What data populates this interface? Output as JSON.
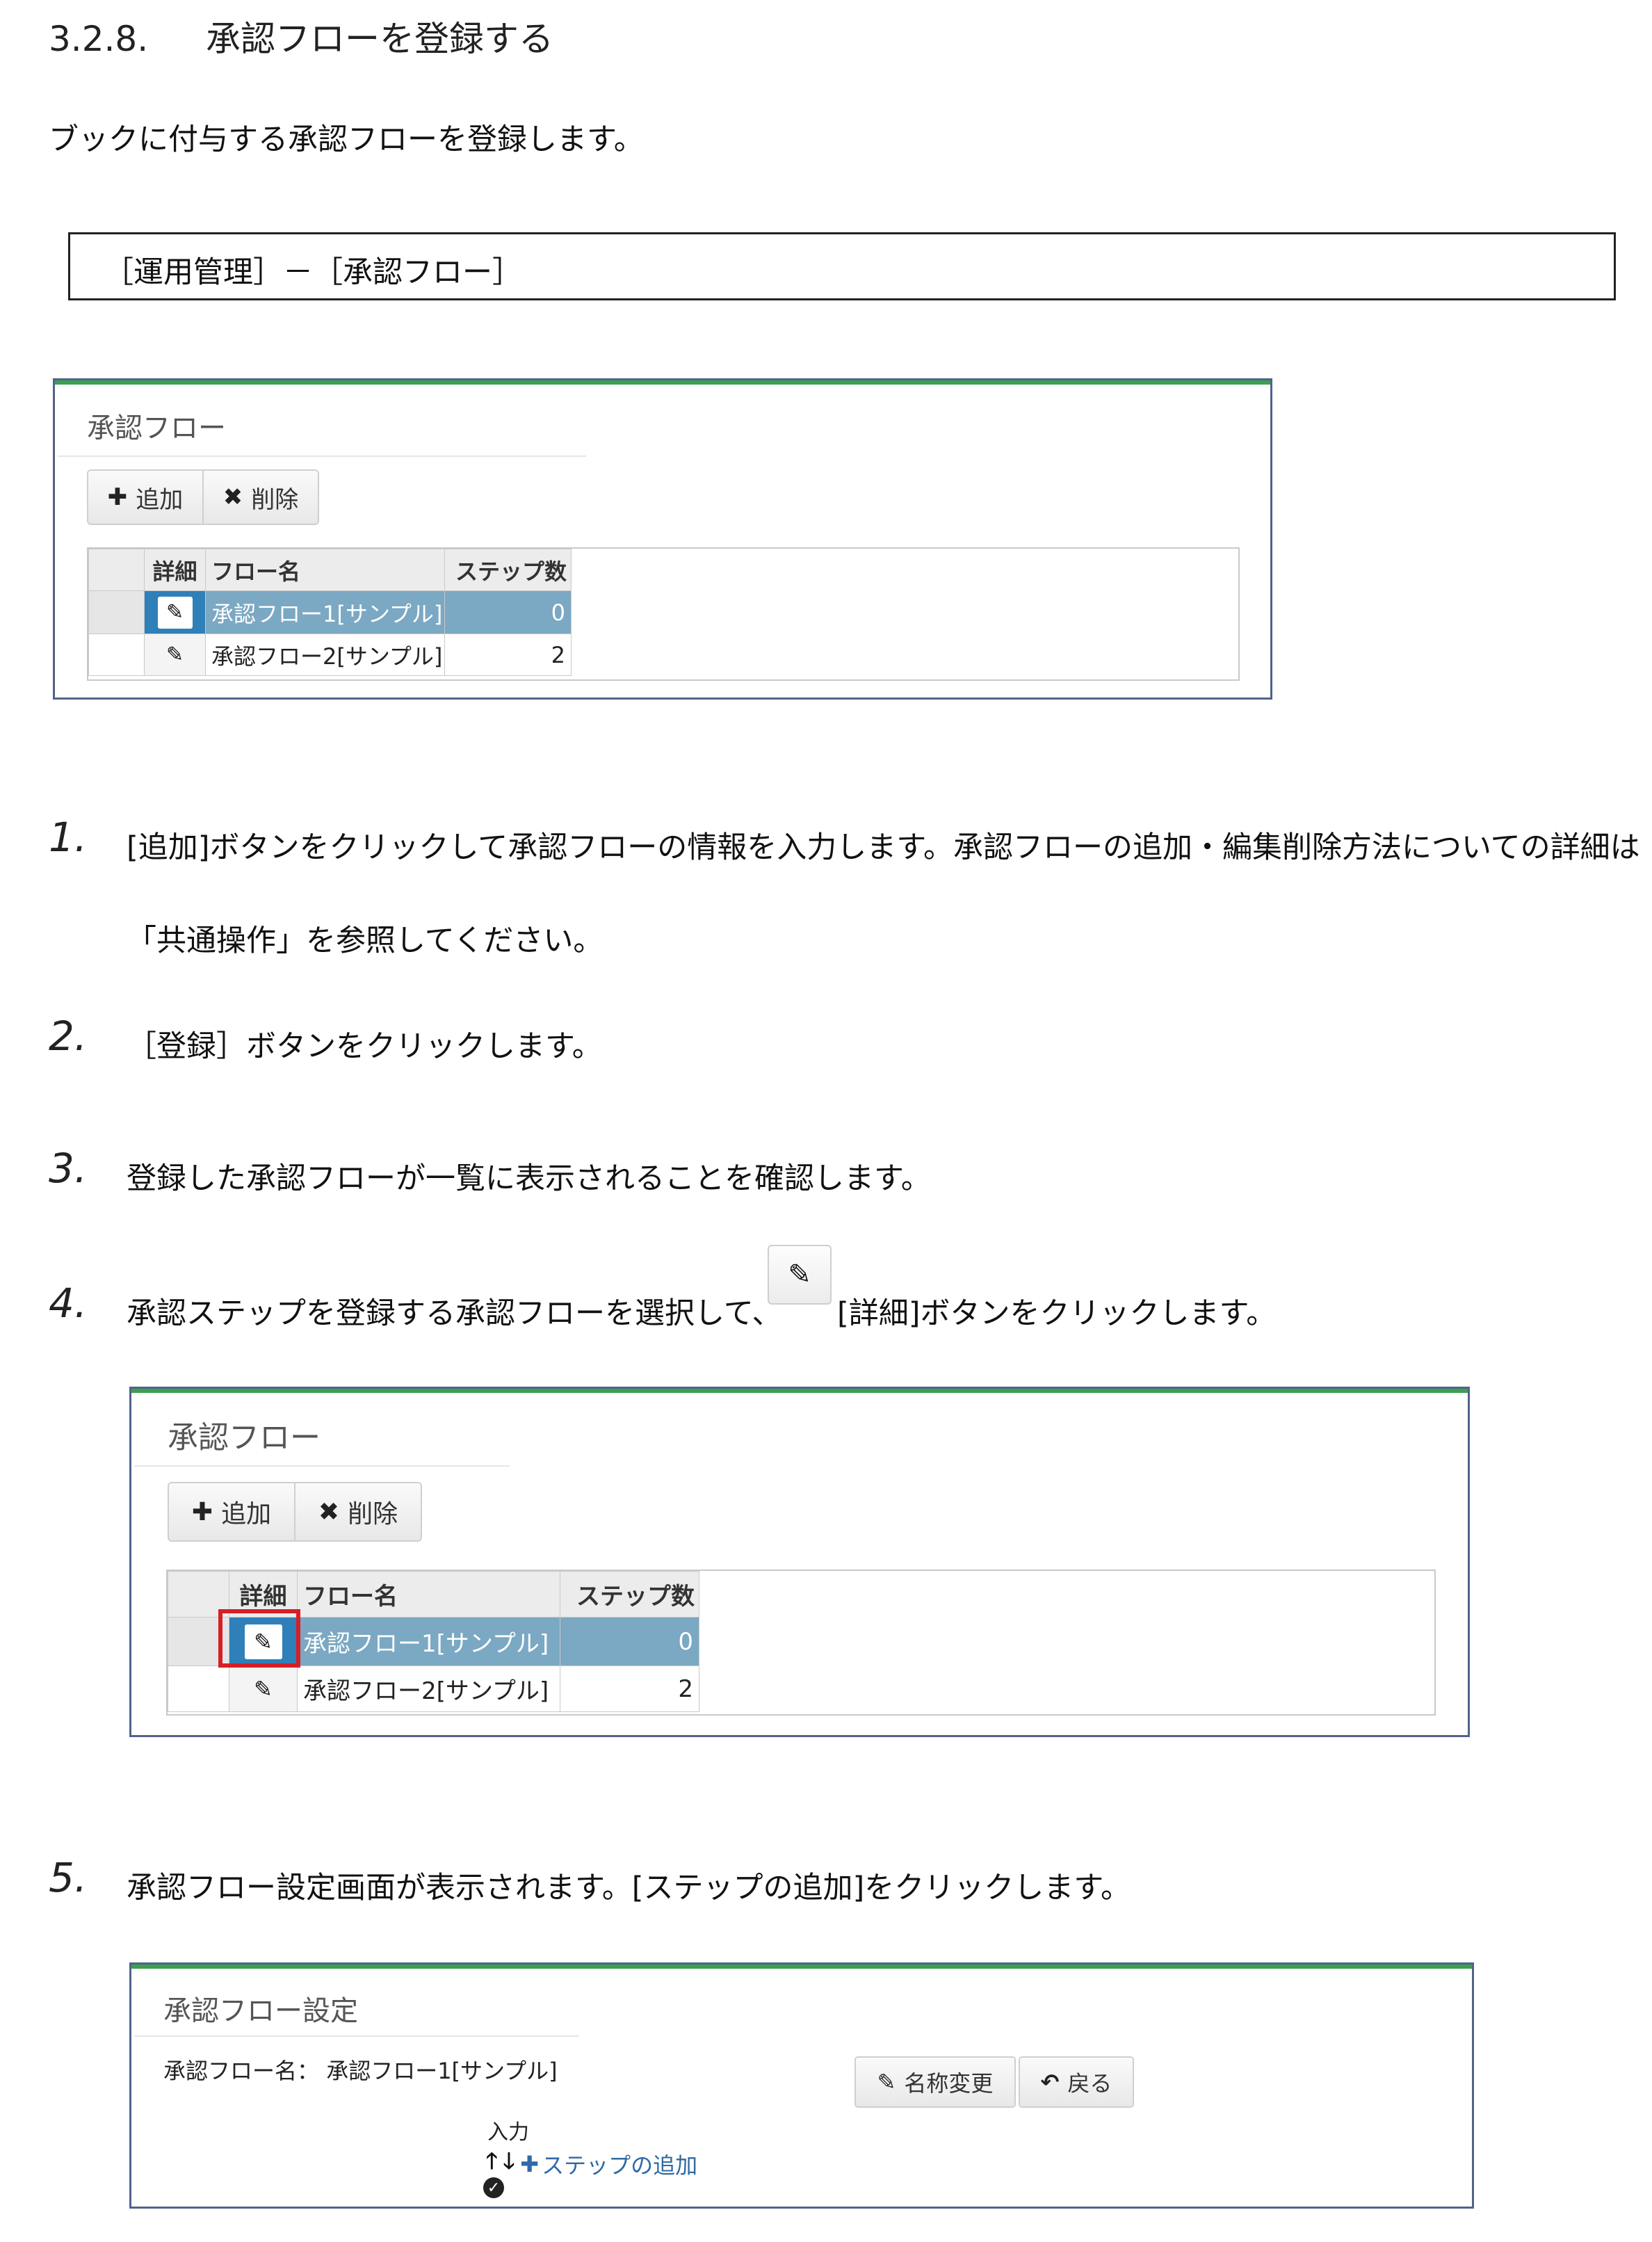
{
  "section": {
    "number": "3.2.8.",
    "title": "承認フローを登録する"
  },
  "intro": "ブックに付与する承認フローを登録します。",
  "menu_path": "［運用管理］－［承認フロー］",
  "screen1": {
    "title": "承認フロー",
    "add_label": "追加",
    "delete_label": "削除",
    "add_icon": "plus-icon",
    "delete_icon": "x-icon",
    "columns": [
      "詳細",
      "フロー名",
      "ステップ数"
    ],
    "rows": [
      {
        "name": "承認フロー1[サンプル]",
        "steps": "0",
        "selected": true
      },
      {
        "name": "承認フロー2[サンプル]",
        "steps": "2",
        "selected": false
      }
    ]
  },
  "steps": [
    {
      "num": "1.",
      "line1": "[追加]ボタンをクリックして承認フローの情報を入力します。承認フローの追加・編集削除方法についての詳細は",
      "line2": "「共通操作」を参照してください。"
    },
    {
      "num": "2.",
      "text": "［登録］ボタンをクリックします。"
    },
    {
      "num": "3.",
      "text": "登録した承認フローが一覧に表示されることを確認します。"
    },
    {
      "num": "4.",
      "text_before": "承認ステップを登録する承認フローを選択して、",
      "text_after": "[詳細]ボタンをクリックします。"
    },
    {
      "num": "5.",
      "text": "承認フロー設定画面が表示されます。[ステップの追加]をクリックします。"
    }
  ],
  "screen2": {
    "title": "承認フロー",
    "add_label": "追加",
    "delete_label": "削除",
    "columns": [
      "詳細",
      "フロー名",
      "ステップ数"
    ],
    "rows": [
      {
        "name": "承認フロー1[サンプル]",
        "steps": "0",
        "selected": true
      },
      {
        "name": "承認フロー2[サンプル]",
        "steps": "2",
        "selected": false
      }
    ],
    "highlight_color": "#d71f26"
  },
  "screen3": {
    "title": "承認フロー設定",
    "flow_name_label": "承認フロー名：",
    "flow_name_value": "承認フロー1[サンプル]",
    "rename_label": "名称変更",
    "back_label": "戻る",
    "input_label": "入力",
    "add_step_label": "ステップの追加",
    "icons": [
      "pencil-icon",
      "undo-icon",
      "arrow-up-icon",
      "arrow-down-icon",
      "plus-icon",
      "check-circle-icon"
    ]
  },
  "colors": {
    "panel_border": "#51638c",
    "panel_top": "#3aa14f",
    "row_selected": "#7ba8c2",
    "detail_selected": "#2f7fb9",
    "link": "#2f6aa5"
  }
}
